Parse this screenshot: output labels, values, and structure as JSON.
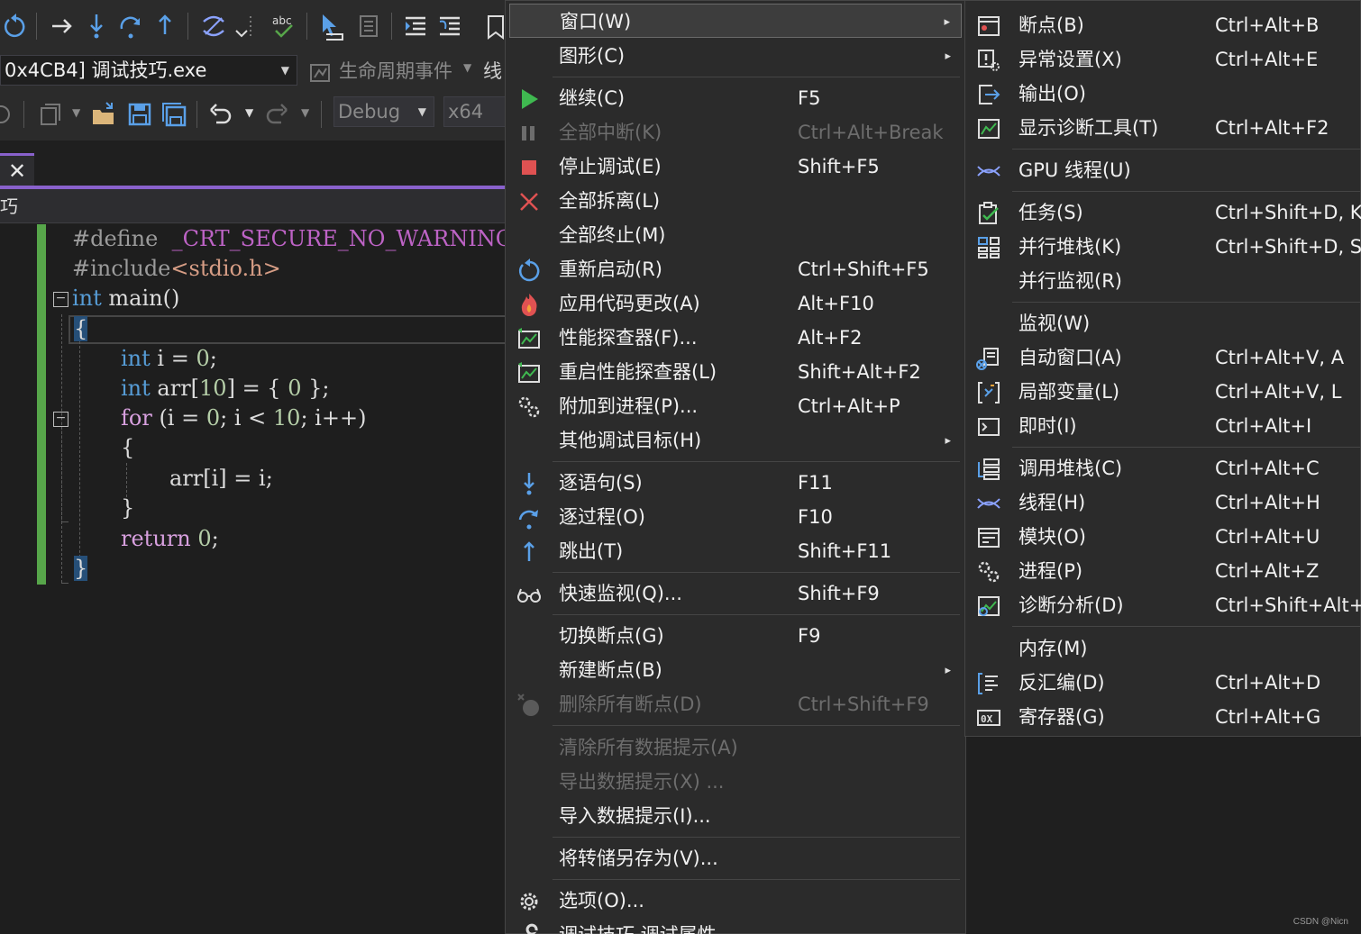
{
  "toolbar": {
    "process_combo": "0x4CB4] 调试技巧.exe",
    "lifecycle_label": "生命周期事件",
    "thread_label": "线",
    "config_combo": "Debug",
    "platform_combo": "x64"
  },
  "tab": {
    "close_glyph": "✕"
  },
  "navbar": {
    "text": "巧"
  },
  "code": {
    "line1_directive": "#define",
    "line1_macro": "_CRT_SECURE_NO_WARNINGS",
    "line2_directive": "#include",
    "line2_header": "<stdio.h>",
    "line3_type": "int",
    "line3_name": " main()",
    "line4": "{",
    "line5_type": "int",
    "line5_rest": " i = ",
    "line5_num": "0",
    "line5_end": ";",
    "line6_type": "int",
    "line6_rest": " arr[",
    "line6_num1": "10",
    "line6_mid": "] = { ",
    "line6_num2": "0",
    "line6_end": " };",
    "line7_kw": "for",
    "line7_rest1": " (i = ",
    "line7_num1": "0",
    "line7_rest2": "; i < ",
    "line7_num2": "10",
    "line7_rest3": "; i++)",
    "line8": "{",
    "line9": "arr[i] = i;",
    "line10": "}",
    "line11_kw": "return",
    "line11_num": " 0",
    "line11_end": ";",
    "line12": "}"
  },
  "menu_main": {
    "items": [
      {
        "label": "窗口(W)",
        "shortcut": "",
        "submenu": "▸"
      },
      {
        "label": "图形(C)",
        "shortcut": "",
        "submenu": "▸"
      },
      {
        "label": "继续(C)",
        "shortcut": "F5"
      },
      {
        "label": "全部中断(K)",
        "shortcut": "Ctrl+Alt+Break"
      },
      {
        "label": "停止调试(E)",
        "shortcut": "Shift+F5"
      },
      {
        "label": "全部拆离(L)",
        "shortcut": ""
      },
      {
        "label": "全部终止(M)",
        "shortcut": ""
      },
      {
        "label": "重新启动(R)",
        "shortcut": "Ctrl+Shift+F5"
      },
      {
        "label": "应用代码更改(A)",
        "shortcut": "Alt+F10"
      },
      {
        "label": "性能探查器(F)...",
        "shortcut": "Alt+F2"
      },
      {
        "label": "重启性能探查器(L)",
        "shortcut": "Shift+Alt+F2"
      },
      {
        "label": "附加到进程(P)...",
        "shortcut": "Ctrl+Alt+P"
      },
      {
        "label": "其他调试目标(H)",
        "shortcut": "",
        "submenu": "▸"
      },
      {
        "label": "逐语句(S)",
        "shortcut": "F11"
      },
      {
        "label": "逐过程(O)",
        "shortcut": "F10"
      },
      {
        "label": "跳出(T)",
        "shortcut": "Shift+F11"
      },
      {
        "label": "快速监视(Q)...",
        "shortcut": "Shift+F9"
      },
      {
        "label": "切换断点(G)",
        "shortcut": "F9"
      },
      {
        "label": "新建断点(B)",
        "shortcut": "",
        "submenu": "▸"
      },
      {
        "label": "删除所有断点(D)",
        "shortcut": "Ctrl+Shift+F9"
      },
      {
        "label": "清除所有数据提示(A)",
        "shortcut": ""
      },
      {
        "label": "导出数据提示(X) ...",
        "shortcut": ""
      },
      {
        "label": "导入数据提示(I)...",
        "shortcut": ""
      },
      {
        "label": "将转储另存为(V)...",
        "shortcut": ""
      },
      {
        "label": "选项(O)...",
        "shortcut": ""
      },
      {
        "label": "调试技巧 调试属性",
        "shortcut": ""
      }
    ]
  },
  "menu_sub": {
    "items": [
      {
        "label": "断点(B)",
        "shortcut": "Ctrl+Alt+B"
      },
      {
        "label": "异常设置(X)",
        "shortcut": "Ctrl+Alt+E"
      },
      {
        "label": "输出(O)",
        "shortcut": ""
      },
      {
        "label": "显示诊断工具(T)",
        "shortcut": "Ctrl+Alt+F2"
      },
      {
        "label": "GPU 线程(U)",
        "shortcut": ""
      },
      {
        "label": "任务(S)",
        "shortcut": "Ctrl+Shift+D, K"
      },
      {
        "label": "并行堆栈(K)",
        "shortcut": "Ctrl+Shift+D, S"
      },
      {
        "label": "并行监视(R)",
        "shortcut": ""
      },
      {
        "label": "监视(W)",
        "shortcut": ""
      },
      {
        "label": "自动窗口(A)",
        "shortcut": "Ctrl+Alt+V, A"
      },
      {
        "label": "局部变量(L)",
        "shortcut": "Ctrl+Alt+V, L"
      },
      {
        "label": "即时(I)",
        "shortcut": "Ctrl+Alt+I"
      },
      {
        "label": "调用堆栈(C)",
        "shortcut": "Ctrl+Alt+C"
      },
      {
        "label": "线程(H)",
        "shortcut": "Ctrl+Alt+H"
      },
      {
        "label": "模块(O)",
        "shortcut": "Ctrl+Alt+U"
      },
      {
        "label": "进程(P)",
        "shortcut": "Ctrl+Alt+Z"
      },
      {
        "label": "诊断分析(D)",
        "shortcut": "Ctrl+Shift+Alt+I"
      },
      {
        "label": "内存(M)",
        "shortcut": ""
      },
      {
        "label": "反汇编(D)",
        "shortcut": "Ctrl+Alt+D"
      },
      {
        "label": "寄存器(G)",
        "shortcut": "Ctrl+Alt+G"
      }
    ]
  },
  "watermark": "CSDN @Nicn",
  "colors": {
    "accent_purple": "#8961cc",
    "change_bar": "#57a64a",
    "keyword": "#569cd6",
    "menu_bg": "#2b2b2b"
  }
}
